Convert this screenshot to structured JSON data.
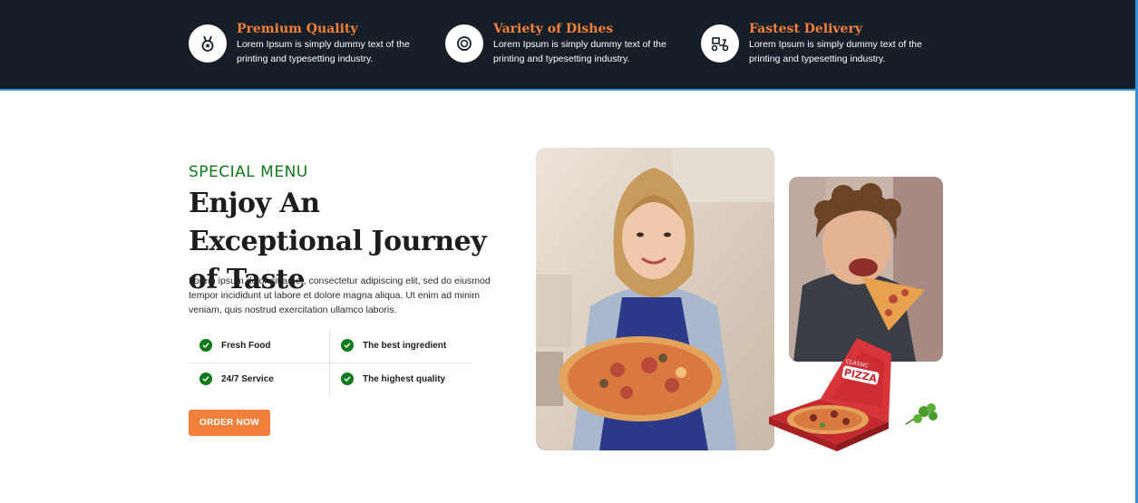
{
  "features": [
    {
      "title": "Premium Quality",
      "desc": "Lorem Ipsum is simply dummy text of the printing and typesetting industry.",
      "icon": "medal-icon"
    },
    {
      "title": "Variety of Dishes",
      "desc": "Lorem Ipsum is simply dummy text of the printing and typesetting industry.",
      "icon": "dish-icon"
    },
    {
      "title": "Fastest Delivery",
      "desc": "Lorem Ipsum is simply dummy text of the printing and typesetting industry.",
      "icon": "delivery-scooter-icon"
    }
  ],
  "special": {
    "eyebrow": "SPECIAL MENU",
    "headline": "Enjoy An Exceptional Journey of Taste",
    "body": "Lorem ipsum dolor sit amet, consectetur adipiscing elit, sed do eiusmod tempor incididunt ut labore et dolore magna aliqua. Ut enim ad minim veniam, quis nostrud exercitation ullamco laboris.",
    "items": [
      "Fresh Food",
      "The best ingredient",
      "24/7 Service",
      "The highest quality"
    ],
    "cta": "ORDER NOW"
  },
  "images": {
    "main": "woman-holding-pizza-photo",
    "side": "man-eating-pizza-photo",
    "box_label": "PIZZA",
    "box_sublabel": "CLASSIC"
  },
  "colors": {
    "dark_bar": "#161e28",
    "accent_orange": "#f2803a",
    "green": "#0f7a1a"
  }
}
